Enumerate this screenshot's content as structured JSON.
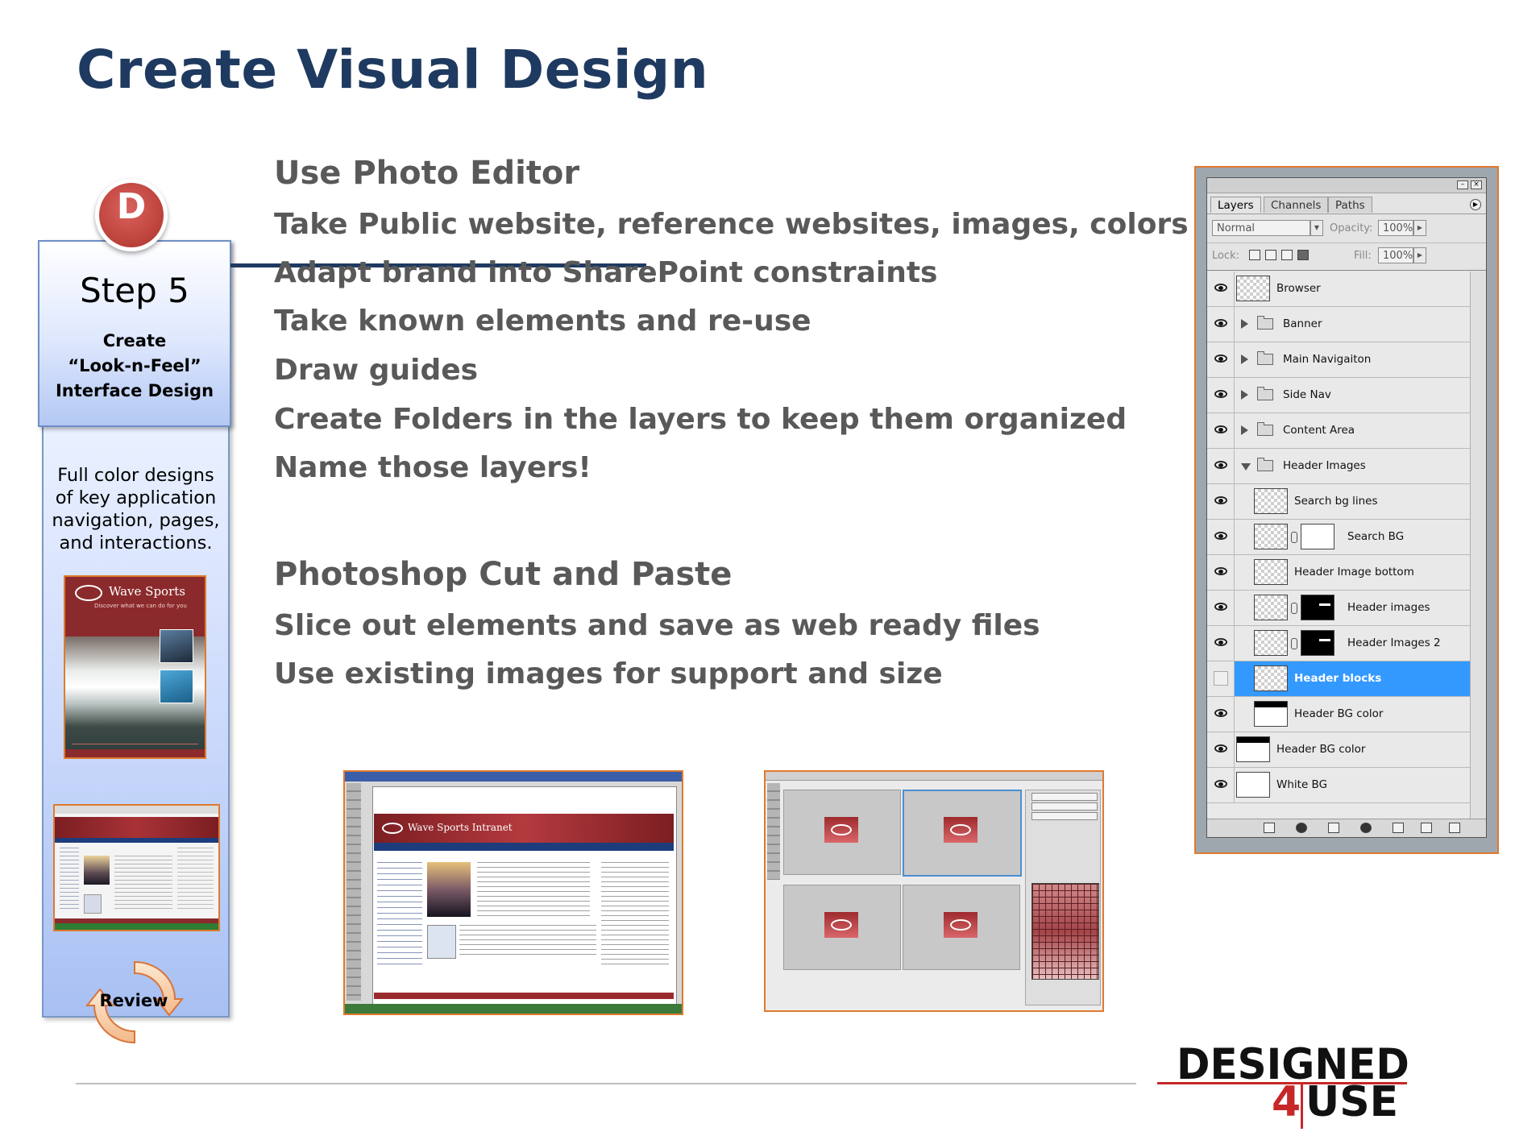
{
  "slide": {
    "title": "Create Visual Design"
  },
  "step_panel": {
    "badge_letter": "D",
    "step_number": "Step 5",
    "step_label_lines": [
      "Create",
      "“Look-n-Feel”",
      "Interface Design"
    ],
    "description_lines": [
      "Full color designs",
      "of key application",
      "navigation, pages,",
      "and interactions."
    ],
    "review_label": "Review",
    "poster": {
      "brand": "Wave Sports",
      "tagline": "Discover what we can do for you"
    }
  },
  "content": {
    "section1": {
      "heading": "Use Photo Editor",
      "bullets": [
        "Take Public website, reference websites, images, colors etc.",
        "Adapt brand into SharePoint constraints",
        "Take known elements and re-use",
        "Draw guides",
        "Create Folders in the layers to keep them organized",
        "Name those layers!"
      ]
    },
    "section2": {
      "heading": "Photoshop Cut and Paste",
      "bullets": [
        "Slice out elements and save as web ready files",
        "Use existing images for support and size"
      ]
    }
  },
  "screenshots": {
    "intranet_brand": "Wave Sports Intranet"
  },
  "layers_panel": {
    "tabs": [
      "Layers",
      "Channels",
      "Paths"
    ],
    "active_tab": "Layers",
    "blend_mode": "Normal",
    "opacity_label": "Opacity:",
    "opacity_value": "100%",
    "lock_label": "Lock:",
    "fill_label": "Fill:",
    "fill_value": "100%",
    "layers": [
      {
        "name": "Browser",
        "visible": true,
        "kind": "layer",
        "thumb": "checker"
      },
      {
        "name": "Banner",
        "visible": true,
        "kind": "folder",
        "expanded": false
      },
      {
        "name": "Main Navigaiton",
        "visible": true,
        "kind": "folder",
        "expanded": false
      },
      {
        "name": "Side Nav",
        "visible": true,
        "kind": "folder",
        "expanded": false
      },
      {
        "name": "Content Area",
        "visible": true,
        "kind": "folder",
        "expanded": false
      },
      {
        "name": "Header Images",
        "visible": true,
        "kind": "folder",
        "expanded": true
      },
      {
        "name": "Search bg lines",
        "visible": true,
        "kind": "child",
        "thumb": "checker"
      },
      {
        "name": "Search BG",
        "visible": true,
        "kind": "child",
        "thumb": "checker",
        "mask": "white"
      },
      {
        "name": "Header Image bottom",
        "visible": true,
        "kind": "child",
        "thumb": "checker"
      },
      {
        "name": "Header images",
        "visible": true,
        "kind": "child",
        "thumb": "checker",
        "mask": "black"
      },
      {
        "name": "Header Images 2",
        "visible": true,
        "kind": "child",
        "thumb": "checker",
        "mask": "black"
      },
      {
        "name": "Header blocks",
        "visible": false,
        "kind": "child",
        "thumb": "checker",
        "selected": true
      },
      {
        "name": "Header BG color",
        "visible": true,
        "kind": "child",
        "thumb": "headerbg"
      },
      {
        "name": "Header BG color",
        "visible": true,
        "kind": "layer",
        "thumb": "headerbg"
      },
      {
        "name": "White BG",
        "visible": true,
        "kind": "layer",
        "thumb": "white"
      }
    ]
  },
  "footer": {
    "logo_line1": "DESIGNED",
    "logo_line2_number": "4",
    "logo_line2_text": "USE"
  },
  "colors": {
    "title": "#1f3a60",
    "body_text": "#595959",
    "badge_red": "#c0453f",
    "accent_orange": "#e07a2e",
    "selection_blue": "#3399ff",
    "logo_red": "#c62828"
  }
}
